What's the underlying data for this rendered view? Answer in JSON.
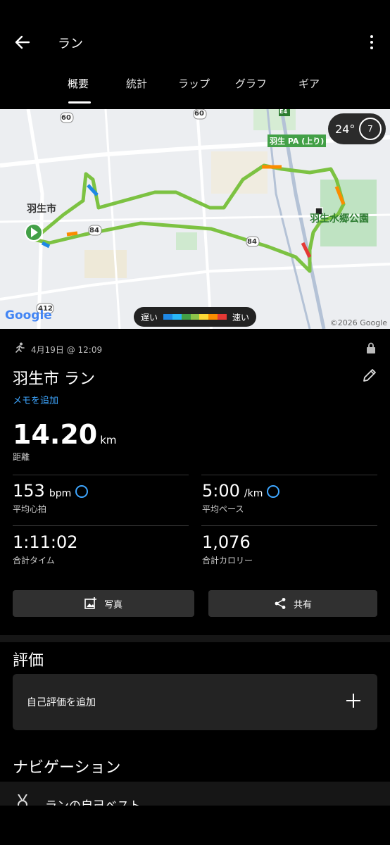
{
  "header": {
    "title": "ラン"
  },
  "tabs": [
    {
      "label": "概要",
      "active": true
    },
    {
      "label": "統計",
      "active": false
    },
    {
      "label": "ラップ",
      "active": false
    },
    {
      "label": "グラフ",
      "active": false
    },
    {
      "label": "ギア",
      "active": false
    }
  ],
  "map": {
    "weather_temp": "24°",
    "weather_wind": "7",
    "labels": {
      "city": "羽生市",
      "park": "羽生水郷公園",
      "pa": "羽生 PA (上り)",
      "road_84a": "84",
      "road_84b": "84",
      "road_60a": "60",
      "road_60b": "60",
      "road_412": "412",
      "road_e4": "E4"
    },
    "legend_slow": "遅い",
    "legend_fast": "速い",
    "legend_colors": [
      "#1e88e5",
      "#29b6f6",
      "#43a047",
      "#8bc34a",
      "#fdd835",
      "#fb8c00",
      "#e53935"
    ],
    "google": "Google",
    "copyright": "©2026 Google"
  },
  "activity": {
    "date": "4月19日 @ 12:09",
    "title": "羽生市 ラン",
    "memo_link": "メモを追加",
    "distance_value": "14.20",
    "distance_unit": "km",
    "distance_label": "距離"
  },
  "stats": {
    "heart_rate_value": "153",
    "heart_rate_unit": "bpm",
    "heart_rate_label": "平均心拍",
    "pace_value": "5:00",
    "pace_unit": "/km",
    "pace_label": "平均ペース",
    "time_value": "1:11:02",
    "time_label": "合計タイム",
    "calories_value": "1,076",
    "calories_label": "合計カロリー"
  },
  "buttons": {
    "photo": "写真",
    "share": "共有"
  },
  "rating": {
    "section_title": "評価",
    "add_label": "自己評価を追加"
  },
  "navigation": {
    "section_title": "ナビゲーション",
    "item_label": "ランの自己ベスト"
  },
  "colors": {
    "accent": "#3ea6ff",
    "route_green": "#7cc242"
  }
}
